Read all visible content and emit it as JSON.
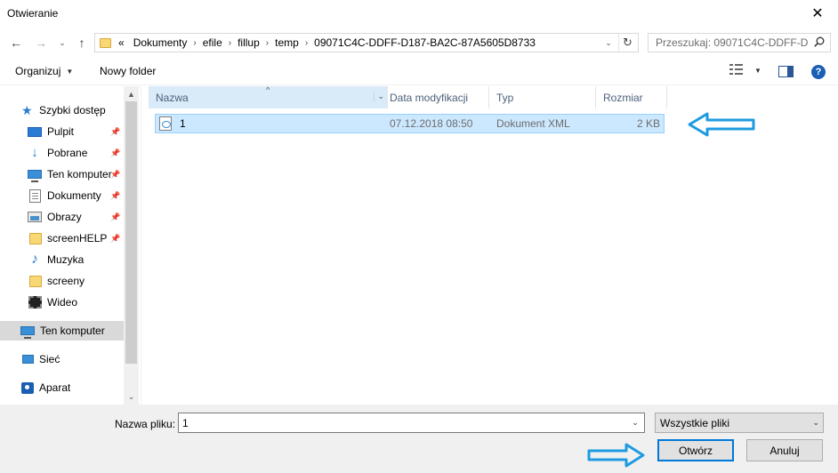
{
  "window": {
    "title": "Otwieranie",
    "close_glyph": "✕"
  },
  "nav": {
    "back_glyph": "←",
    "forward_glyph": "→",
    "history_glyph": "⌄",
    "up_glyph": "↑",
    "address_prefix": "«",
    "breadcrumbs": [
      "Dokumenty",
      "efile",
      "fillup",
      "temp",
      "09071C4C-DDFF-D187-BA2C-87A5605D8733"
    ],
    "crumb_separator": "›",
    "address_drop_glyph": "⌄",
    "refresh_glyph": "↻",
    "search_placeholder": "Przeszukaj: 09071C4C-DDFF-D...",
    "search_icon": "search-icon"
  },
  "toolbar": {
    "organize_label": "Organizuj",
    "new_folder_label": "Nowy folder",
    "caret_glyph": "▼",
    "help_glyph": "?"
  },
  "sidebar": {
    "pin_glyph": "📌",
    "items": [
      {
        "label": "Szybki dostęp",
        "icon": "star-icon",
        "pinned": false
      },
      {
        "label": "Pulpit",
        "icon": "desktop-icon",
        "pinned": true
      },
      {
        "label": "Pobrane",
        "icon": "download-icon",
        "pinned": true
      },
      {
        "label": "Ten komputer",
        "icon": "computer-icon",
        "pinned": true
      },
      {
        "label": "Dokumenty",
        "icon": "documents-icon",
        "pinned": true
      },
      {
        "label": "Obrazy",
        "icon": "images-icon",
        "pinned": true
      },
      {
        "label": "screenHELP",
        "icon": "folder-icon",
        "pinned": true
      },
      {
        "label": "Muzyka",
        "icon": "music-icon",
        "pinned": false
      },
      {
        "label": "screeny",
        "icon": "folder-icon",
        "pinned": false
      },
      {
        "label": "Wideo",
        "icon": "video-icon",
        "pinned": false
      },
      {
        "label": "Ten komputer",
        "icon": "computer-icon",
        "pinned": false,
        "selected": true
      },
      {
        "label": "Sieć",
        "icon": "network-icon",
        "pinned": false
      },
      {
        "label": "Aparat",
        "icon": "camera-icon",
        "pinned": false
      }
    ],
    "scroll_up_glyph": "▲",
    "scroll_down_glyph": "⌄"
  },
  "filelist": {
    "columns": {
      "name": "Nazwa",
      "date": "Data modyfikacji",
      "type": "Typ",
      "size": "Rozmiar"
    },
    "sort_glyph": "^",
    "drop_glyph": "⌄",
    "rows": [
      {
        "name": "1",
        "date": "07.12.2018 08:50",
        "type": "Dokument XML",
        "size": "2 KB",
        "icon": "xml-file-icon",
        "selected": true
      }
    ]
  },
  "footer": {
    "filename_label": "Nazwa pliku:",
    "filename_value": "1",
    "filter_value": "Wszystkie pliki",
    "drop_glyph": "⌄",
    "open_label": "Otwórz",
    "cancel_label": "Anuluj"
  },
  "colors": {
    "selection_bg": "#cce8ff",
    "selection_border": "#99d1ff",
    "header_active_bg": "#d9ebf9",
    "accent": "#0078d7",
    "annotation_arrow": "#1e9be0",
    "panel_bg": "#f0f0f0"
  }
}
